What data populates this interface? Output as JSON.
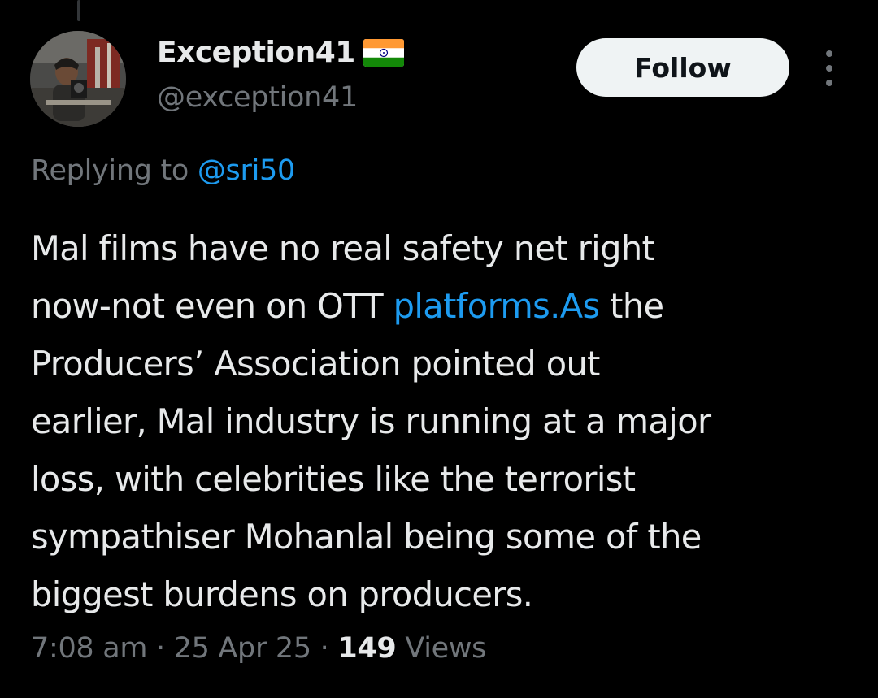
{
  "author": {
    "display_name": "Exception41",
    "handle": "@exception41",
    "flag_icon": "india-flag-icon"
  },
  "actions": {
    "follow_label": "Follow",
    "more_icon": "more-vertical-icon"
  },
  "reply": {
    "prefix": "Replying to",
    "mention": "@sri50"
  },
  "tweet": {
    "line1": "Mal films have no real safety net right",
    "line2_pre": "now-not even on OTT ",
    "line2_link": "platforms.As",
    "line2_post": " the",
    "line3": "Producers’ Association pointed out",
    "line4": "earlier, Mal industry is running at a major",
    "line5": "loss, with celebrities like the terrorist",
    "line6": "sympathiser Mohanlal being some of the",
    "line7": "biggest burdens on producers."
  },
  "meta": {
    "time": "7:08 am",
    "separator": "·",
    "date": "25 Apr 25",
    "views_count": "149",
    "views_label": "Views"
  },
  "colors": {
    "background": "#000000",
    "text_primary": "#e7e9ea",
    "text_secondary": "#71767b",
    "link": "#1d9bf0",
    "button_bg": "#eff3f4"
  }
}
